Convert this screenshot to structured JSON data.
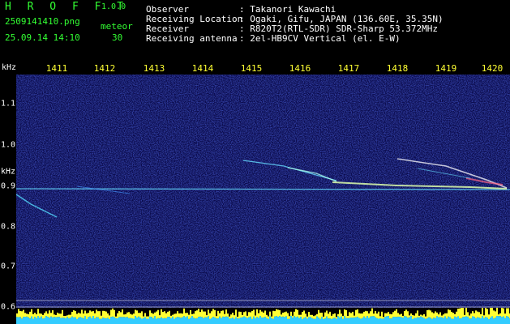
{
  "header": {
    "app_name": "H R O F F T",
    "version": "1.0.0",
    "filename": "2509141410.png",
    "datetime": "25.09.14 14:10",
    "meteor_label": "meteor",
    "meteor_count": "30",
    "fields": [
      {
        "label": "Observer",
        "value": ": Takanori Kawachi"
      },
      {
        "label": "Receiving Location",
        "value": ": Ogaki, Gifu, JAPAN (136.60E, 35.35N)"
      },
      {
        "label": "Receiver",
        "value": ": R820T2(RTL-SDR) SDR-Sharp 53.372MHz"
      },
      {
        "label": "Receiving antenna",
        "value": ": 2el-HB9CV Vertical (el. E-W)"
      }
    ]
  },
  "time_axis": {
    "ticks": [
      "1411",
      "1412",
      "1413",
      "1414",
      "1415",
      "1416",
      "1417",
      "1418",
      "1419",
      "1420"
    ]
  },
  "freq_axis": {
    "unit_top": "kHz",
    "unit_mid": "kHz",
    "labels": [
      "1.1",
      "1.0",
      "0.9",
      "0.8",
      "0.7",
      "0.6"
    ]
  },
  "colors": {
    "header_green": "#33ff33",
    "axis_yellow": "#ffff33",
    "background": "#000000",
    "noise_base": "#0a0a50",
    "carrier": "#66ddff"
  }
}
